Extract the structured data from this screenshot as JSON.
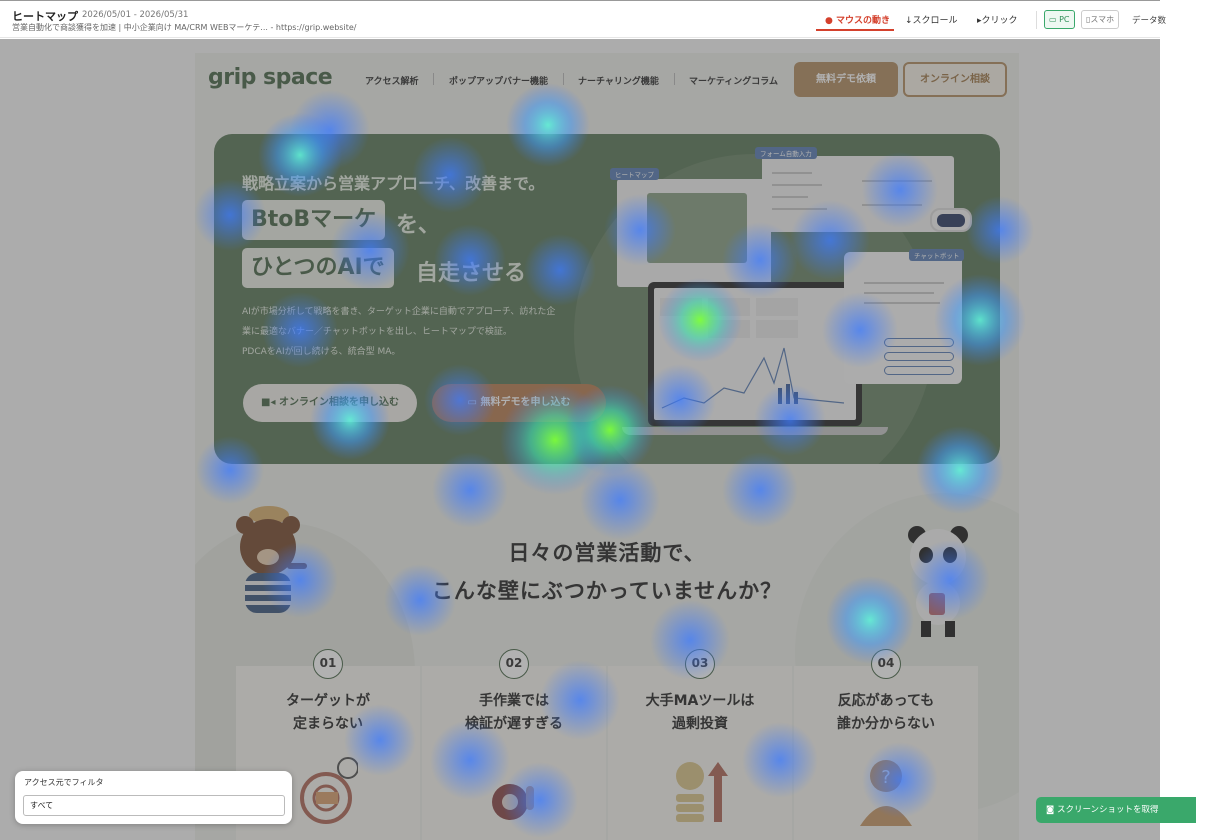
{
  "header": {
    "title": "ヒートマップ",
    "date_range": "2026/05/01 - 2026/05/31",
    "page_subtitle": "営業自動化で商談獲得を加速 | 中小企業向け MA/CRM WEBマーケテ... - https://grip.website/",
    "tabs": [
      {
        "icon": "mouse-icon",
        "label": "マウスの動き",
        "active": true
      },
      {
        "icon": "arrow-down-icon",
        "label": "スクロール",
        "active": false
      },
      {
        "icon": "cursor-icon",
        "label": "クリック",
        "active": false
      }
    ],
    "devices": [
      {
        "icon": "monitor-icon",
        "label": "PC",
        "active": true
      },
      {
        "icon": "phone-icon",
        "label": "スマホ",
        "active": false
      }
    ],
    "data_label": "データ数",
    "accent_color": "#d4402c",
    "device_active_color": "#3aa86b"
  },
  "site": {
    "logo": "grip space",
    "nav": [
      "アクセス解析",
      "ポップアップバナー機能",
      "ナーチャリング機能",
      "マーケティングコラム"
    ],
    "demo_button": "無料デモ依頼",
    "consult_button": "オンライン相談",
    "hero": {
      "line1": "戦略立案から営業アプローチ、改善まで。",
      "pill1": "BtoBマーケ",
      "after1": "を、",
      "pill2": "ひとつのAIで",
      "after2": "自走させる",
      "desc1": "AIが市場分析して戦略を書き、ターゲット企業に自動でアプローチ、訪れた企",
      "desc2": "業に最適なバナー／チャットボットを出し、ヒートマップで検証。",
      "desc3": "PDCAをAIが回し続ける、統合型 MA。",
      "cta_online": "オンライン相談を申し込む",
      "cta_demo": "無料デモを申し込む",
      "mock_tags": {
        "heatmap": "ヒートマップ",
        "form": "フォーム自動入力",
        "chatbot": "チャットボット"
      }
    },
    "section_title_1": "日々の営業活動で、",
    "section_title_2": "こんな壁にぶつかっていませんか？",
    "cards": [
      {
        "num": "01",
        "line1": "ターゲットが",
        "line2": "定まらない",
        "icon": "target-megaphone-icon"
      },
      {
        "num": "02",
        "line1": "手作業では",
        "line2": "検証が遅すぎる",
        "icon": "snail-icon"
      },
      {
        "num": "03",
        "line1": "大手MAツールは",
        "line2": "過剰投資",
        "icon": "coins-arrow-icon"
      },
      {
        "num": "04",
        "line1": "反応があっても",
        "line2": "誰か分からない",
        "icon": "unknown-person-icon"
      }
    ]
  },
  "filter": {
    "label": "アクセス元でフィルタ",
    "value": "すべて"
  },
  "screenshot_button": "スクリーンショットを取得"
}
